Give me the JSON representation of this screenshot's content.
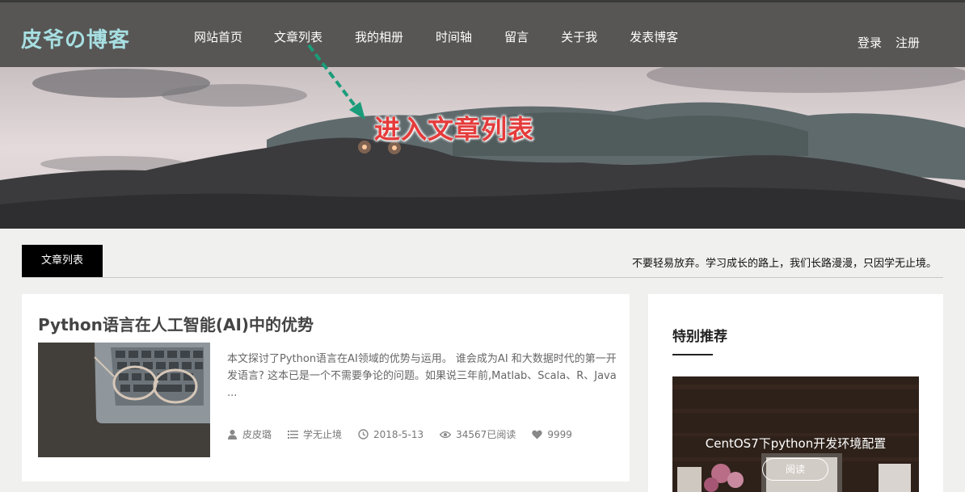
{
  "header": {
    "logo": "皮爷の博客",
    "nav": [
      "网站首页",
      "文章列表",
      "我的相册",
      "时间轴",
      "留言",
      "关于我",
      "发表博客"
    ],
    "login": "登录",
    "register": "注册"
  },
  "annotation": {
    "text": "进入文章列表",
    "color": "#e53b3b"
  },
  "section": {
    "tab_label": "文章列表",
    "motto": "不要轻易放弃。学习成长的路上，我们长路漫漫，只因学无止境。"
  },
  "article": {
    "title": "Python语言在人工智能(AI)中的优势",
    "excerpt": "本文探讨了Python语言在AI领域的优势与运用。 谁会成为AI 和大数据时代的第一开发语言? 这本已是一个不需要争论的问题。如果说三年前,Matlab、Scala、R、Java ...",
    "author": "皮皮璐",
    "category": "学无止境",
    "date": "2018-5-13",
    "views": "34567已阅读",
    "likes": "9999"
  },
  "sidebar": {
    "title": "特别推荐",
    "featured_title": "CentOS7下python开发环境配置",
    "read_button": "阅读"
  },
  "colors": {
    "header_bg": "#575654",
    "logo": "#a7dfe2",
    "page_bg": "#f0f0ee",
    "arrow": "#1a9c7a"
  }
}
